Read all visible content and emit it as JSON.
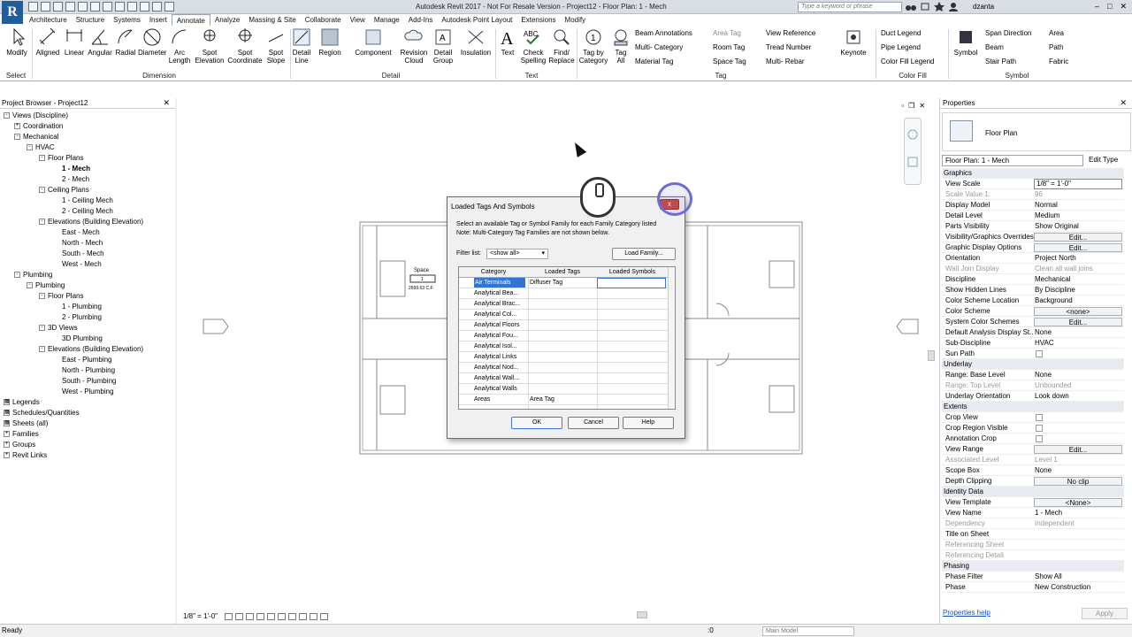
{
  "app": {
    "logo": "R",
    "title": "Autodesk Revit 2017 - Not For Resale Version -   Project12 - Floor Plan: 1 - Mech",
    "search_placeholder": "Type a keyword or phrase",
    "user": "dzanta"
  },
  "ribbon_tabs": [
    {
      "label": "Architecture"
    },
    {
      "label": "Structure"
    },
    {
      "label": "Systems"
    },
    {
      "label": "Insert"
    },
    {
      "label": "Annotate"
    },
    {
      "label": "Analyze"
    },
    {
      "label": "Massing & Site"
    },
    {
      "label": "Collaborate"
    },
    {
      "label": "View"
    },
    {
      "label": "Manage"
    },
    {
      "label": "Add-Ins"
    },
    {
      "label": "Autodesk Point Layout"
    },
    {
      "label": "Extensions"
    },
    {
      "label": "Modify"
    }
  ],
  "ribbon": {
    "big_buttons": [
      {
        "label": "Modify"
      },
      {
        "label": "Aligned"
      },
      {
        "label": "Linear"
      },
      {
        "label": "Angular"
      },
      {
        "label": "Radial"
      },
      {
        "label": "Diameter"
      },
      {
        "label": "Arc\nLength"
      },
      {
        "label": "Spot\nElevation"
      },
      {
        "label": "Spot\nCoordinate"
      },
      {
        "label": "Spot\nSlope"
      },
      {
        "label": "Detail\nLine"
      },
      {
        "label": "Region"
      },
      {
        "label": "Component"
      },
      {
        "label": "Revision\nCloud"
      },
      {
        "label": "Detail\nGroup"
      },
      {
        "label": "Insulation"
      },
      {
        "label": "Text"
      },
      {
        "label": "Check\nSpelling"
      },
      {
        "label": "Find/\nReplace"
      },
      {
        "label": "Tag by\nCategory"
      },
      {
        "label": "Tag\nAll"
      },
      {
        "label": "Keynote"
      },
      {
        "label": "Symbol"
      }
    ],
    "small_buttons": {
      "tag1": [
        {
          "label": "Beam Annotations"
        },
        {
          "label": "Multi- Category"
        },
        {
          "label": "Material Tag"
        }
      ],
      "tag2": [
        {
          "label": "Area Tag"
        },
        {
          "label": "Room Tag"
        },
        {
          "label": "Space Tag"
        }
      ],
      "tag3": [
        {
          "label": "View Reference"
        },
        {
          "label": "Tread Number"
        },
        {
          "label": "Multi- Rebar"
        }
      ],
      "colorfill": [
        {
          "label": "Duct Legend"
        },
        {
          "label": "Pipe Legend"
        },
        {
          "label": "Color Fill Legend"
        }
      ],
      "symbol1": [
        {
          "label": "Span Direction"
        },
        {
          "label": "Beam"
        },
        {
          "label": "Stair Path"
        }
      ],
      "symbol2": [
        {
          "label": "Area"
        },
        {
          "label": "Path"
        },
        {
          "label": "Fabric"
        }
      ]
    },
    "panels": [
      {
        "label": "Select"
      },
      {
        "label": "Dimension"
      },
      {
        "label": "Detail"
      },
      {
        "label": "Text"
      },
      {
        "label": "Tag"
      },
      {
        "label": "Color Fill"
      },
      {
        "label": "Symbol"
      }
    ]
  },
  "project_browser": {
    "title": "Project Browser - Project12",
    "nodes": [
      {
        "label": "Views (Discipline)"
      },
      {
        "label": "Coordination"
      },
      {
        "label": "Mechanical"
      },
      {
        "label": "HVAC"
      },
      {
        "label": "Floor Plans"
      },
      {
        "label": "1 - Mech"
      },
      {
        "label": "2 - Mech"
      },
      {
        "label": "Ceiling Plans"
      },
      {
        "label": "1 - Ceiling Mech"
      },
      {
        "label": "2 - Ceiling Mech"
      },
      {
        "label": "Elevations (Building Elevation)"
      },
      {
        "label": "East - Mech"
      },
      {
        "label": "North - Mech"
      },
      {
        "label": "South - Mech"
      },
      {
        "label": "West - Mech"
      },
      {
        "label": "Plumbing"
      },
      {
        "label": "Plumbing"
      },
      {
        "label": "Floor Plans"
      },
      {
        "label": "1 - Plumbing"
      },
      {
        "label": "2 - Plumbing"
      },
      {
        "label": "3D Views"
      },
      {
        "label": "3D Plumbing"
      },
      {
        "label": "Elevations (Building Elevation)"
      },
      {
        "label": "East - Plumbing"
      },
      {
        "label": "North - Plumbing"
      },
      {
        "label": "South - Plumbing"
      },
      {
        "label": "West - Plumbing"
      },
      {
        "label": "Legends"
      },
      {
        "label": "Schedules/Quantities"
      },
      {
        "label": "Sheets (all)"
      },
      {
        "label": "Families"
      },
      {
        "label": "Groups"
      },
      {
        "label": "Revit Links"
      }
    ]
  },
  "canvas": {
    "space_tag_name": "Space",
    "space_tag_num": "1",
    "space_area": "2699.63 C.F.",
    "scale": "1/8\" = 1'-0\""
  },
  "dialog": {
    "title": "Loaded Tags And Symbols",
    "close": "x",
    "description": "Select an available Tag or Symbol Family for each Family Category listed",
    "note": "Note: Multi-Category Tag Families are not shown below.",
    "filter_label": "Filter list:",
    "filter_value": "<show all>",
    "load_family": "Load Family...",
    "columns": [
      {
        "label": "Category"
      },
      {
        "label": "Loaded Tags"
      },
      {
        "label": "Loaded Symbols"
      }
    ],
    "rows": [
      {
        "category": "Air Terminals",
        "tag": "Diffuser Tag"
      },
      {
        "category": "Analytical Bea...",
        "tag": ""
      },
      {
        "category": "Analytical Brac...",
        "tag": ""
      },
      {
        "category": "Analytical Col...",
        "tag": ""
      },
      {
        "category": "Analytical Floors",
        "tag": ""
      },
      {
        "category": "Analytical Fou...",
        "tag": ""
      },
      {
        "category": "Analytical Isol...",
        "tag": ""
      },
      {
        "category": "Analytical Links",
        "tag": ""
      },
      {
        "category": "Analytical Nod...",
        "tag": ""
      },
      {
        "category": "Analytical Wall...",
        "tag": ""
      },
      {
        "category": "Analytical Walls",
        "tag": ""
      },
      {
        "category": "Areas",
        "tag": "Area Tag"
      }
    ],
    "ok": "OK",
    "cancel": "Cancel",
    "help": "Help"
  },
  "properties": {
    "title": "Properties",
    "type_name": "Floor Plan",
    "instance": "Floor Plan: 1 - Mech",
    "edit_type": "Edit Type",
    "help_link": "Properties help",
    "apply": "Apply",
    "rows": [
      {
        "name": "Graphics",
        "value": ""
      },
      {
        "name": "View Scale",
        "value": "1/8\" = 1'-0\""
      },
      {
        "name": "Scale Value    1:",
        "value": "96"
      },
      {
        "name": "Display Model",
        "value": "Normal"
      },
      {
        "name": "Detail Level",
        "value": "Medium"
      },
      {
        "name": "Parts Visibility",
        "value": "Show Original"
      },
      {
        "name": "Visibility/Graphics Overrides",
        "value": "Edit..."
      },
      {
        "name": "Graphic Display Options",
        "value": "Edit..."
      },
      {
        "name": "Orientation",
        "value": "Project North"
      },
      {
        "name": "Wall Join Display",
        "value": "Clean all wall joins"
      },
      {
        "name": "Discipline",
        "value": "Mechanical"
      },
      {
        "name": "Show Hidden Lines",
        "value": "By Discipline"
      },
      {
        "name": "Color Scheme Location",
        "value": "Background"
      },
      {
        "name": "Color Scheme",
        "value": "<none>"
      },
      {
        "name": "System Color Schemes",
        "value": "Edit..."
      },
      {
        "name": "Default Analysis Display St...",
        "value": "None"
      },
      {
        "name": "Sub-Discipline",
        "value": "HVAC"
      },
      {
        "name": "Sun Path",
        "value": ""
      },
      {
        "name": "Underlay",
        "value": ""
      },
      {
        "name": "Range: Base Level",
        "value": "None"
      },
      {
        "name": "Range: Top Level",
        "value": "Unbounded"
      },
      {
        "name": "Underlay Orientation",
        "value": "Look down"
      },
      {
        "name": "Extents",
        "value": ""
      },
      {
        "name": "Crop View",
        "value": ""
      },
      {
        "name": "Crop Region Visible",
        "value": ""
      },
      {
        "name": "Annotation Crop",
        "value": ""
      },
      {
        "name": "View Range",
        "value": "Edit..."
      },
      {
        "name": "Associated Level",
        "value": "Level 1"
      },
      {
        "name": "Scope Box",
        "value": "None"
      },
      {
        "name": "Depth Clipping",
        "value": "No clip"
      },
      {
        "name": "Identity Data",
        "value": ""
      },
      {
        "name": "View Template",
        "value": "<None>"
      },
      {
        "name": "View Name",
        "value": "1 - Mech"
      },
      {
        "name": "Dependency",
        "value": "Independent"
      },
      {
        "name": "Title on Sheet",
        "value": ""
      },
      {
        "name": "Referencing Sheet",
        "value": ""
      },
      {
        "name": "Referencing Detail",
        "value": ""
      },
      {
        "name": "Phasing",
        "value": ""
      },
      {
        "name": "Phase Filter",
        "value": "Show All"
      },
      {
        "name": "Phase",
        "value": "New Construction"
      }
    ]
  },
  "status": {
    "text": "Ready",
    "zero": ":0",
    "model": "Main Model"
  }
}
